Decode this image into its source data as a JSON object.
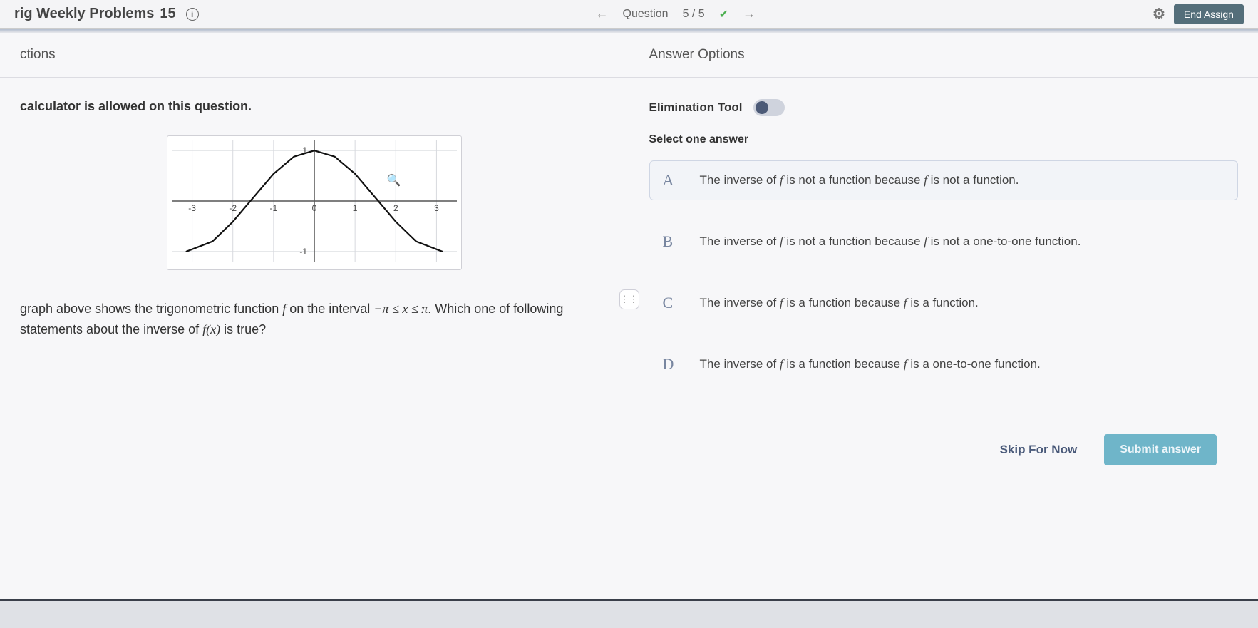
{
  "header": {
    "title_prefix": "rig Weekly Problems",
    "title_num": "15",
    "question_label": "Question",
    "question_counter": "5 / 5",
    "end_label": "End Assign"
  },
  "left": {
    "tab": "ctions",
    "calc_note": "calculator is allowed on this question.",
    "question_pre": "graph above shows the trigonometric function ",
    "question_mid": " on the interval ",
    "interval": "−π ≤ x ≤ π",
    "question_post": ". Which one of following statements about the inverse of ",
    "fx": "f(x)",
    "question_end": " is true?"
  },
  "right": {
    "tab": "Answer Options",
    "elim_label": "Elimination Tool",
    "select_label": "Select one answer",
    "options": [
      {
        "letter": "A",
        "pre": "The inverse of ",
        "mid": " is not a function because ",
        "post": " is not a function."
      },
      {
        "letter": "B",
        "pre": "The inverse of ",
        "mid": " is not a function because ",
        "post": " is not a one-to-one function."
      },
      {
        "letter": "C",
        "pre": "The inverse of ",
        "mid": " is a function because ",
        "post": " is a function."
      },
      {
        "letter": "D",
        "pre": "The inverse of ",
        "mid": " is a function because ",
        "post": " is a one-to-one function."
      }
    ],
    "skip": "Skip For Now",
    "submit": "Submit answer"
  },
  "chart_data": {
    "type": "line",
    "title": "",
    "xlabel": "",
    "ylabel": "",
    "xlim": [
      -3.5,
      3.5
    ],
    "ylim": [
      -1.2,
      1.2
    ],
    "x_ticks": [
      -3,
      -2,
      -1,
      0,
      1,
      2,
      3
    ],
    "y_ticks": [
      -1,
      1
    ],
    "series": [
      {
        "name": "f",
        "x": [
          -3.14,
          -2.5,
          -2.0,
          -1.57,
          -1.0,
          -0.5,
          0.0,
          0.5,
          1.0,
          1.57,
          2.0,
          2.5,
          3.14
        ],
        "y": [
          -1.0,
          -0.8,
          -0.41,
          0.0,
          0.54,
          0.88,
          1.0,
          0.88,
          0.54,
          0.0,
          -0.41,
          -0.8,
          -1.0
        ]
      }
    ]
  }
}
